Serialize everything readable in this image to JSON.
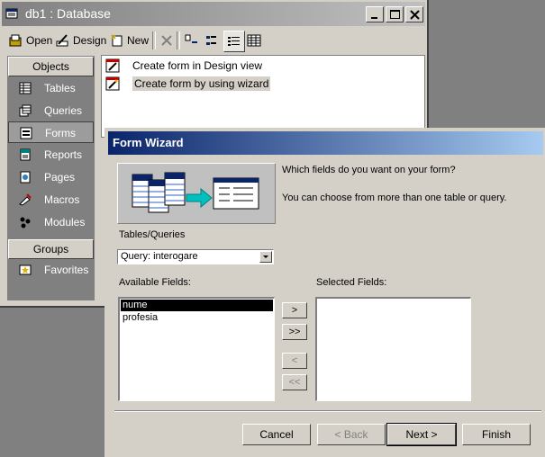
{
  "db_window": {
    "title": "db1 : Database",
    "toolbar": {
      "open_label": "Open",
      "design_label": "Design",
      "new_label": "New"
    },
    "objects_header": "Objects",
    "objects": [
      {
        "label": "Tables",
        "icon": "table-icon"
      },
      {
        "label": "Queries",
        "icon": "query-icon"
      },
      {
        "label": "Forms",
        "icon": "form-icon"
      },
      {
        "label": "Reports",
        "icon": "report-icon"
      },
      {
        "label": "Pages",
        "icon": "page-icon"
      },
      {
        "label": "Macros",
        "icon": "macro-icon"
      },
      {
        "label": "Modules",
        "icon": "module-icon"
      }
    ],
    "selected_object": "Forms",
    "groups_header": "Groups",
    "groups": [
      {
        "label": "Favorites",
        "icon": "favorites-icon"
      }
    ],
    "list_items": [
      {
        "label": "Create form in Design view"
      },
      {
        "label": "Create form by using wizard"
      }
    ]
  },
  "wizard": {
    "title": "Form Wizard",
    "question1": "Which fields do you want on your form?",
    "question2": "You can choose from more than one table or query.",
    "tables_queries_label": "Tables/Queries",
    "tables_queries_value": "Query: interogare",
    "available_label": "Available Fields:",
    "selected_label": "Selected Fields:",
    "available_fields": [
      "nume",
      "profesia"
    ],
    "selected_available_field": "nume",
    "selected_fields": [],
    "move_buttons": {
      "add_one": ">",
      "add_all": ">>",
      "remove_one": "<",
      "remove_all": "<<"
    },
    "buttons": {
      "cancel": "Cancel",
      "back": "< Back",
      "next": "Next >",
      "finish": "Finish"
    }
  }
}
